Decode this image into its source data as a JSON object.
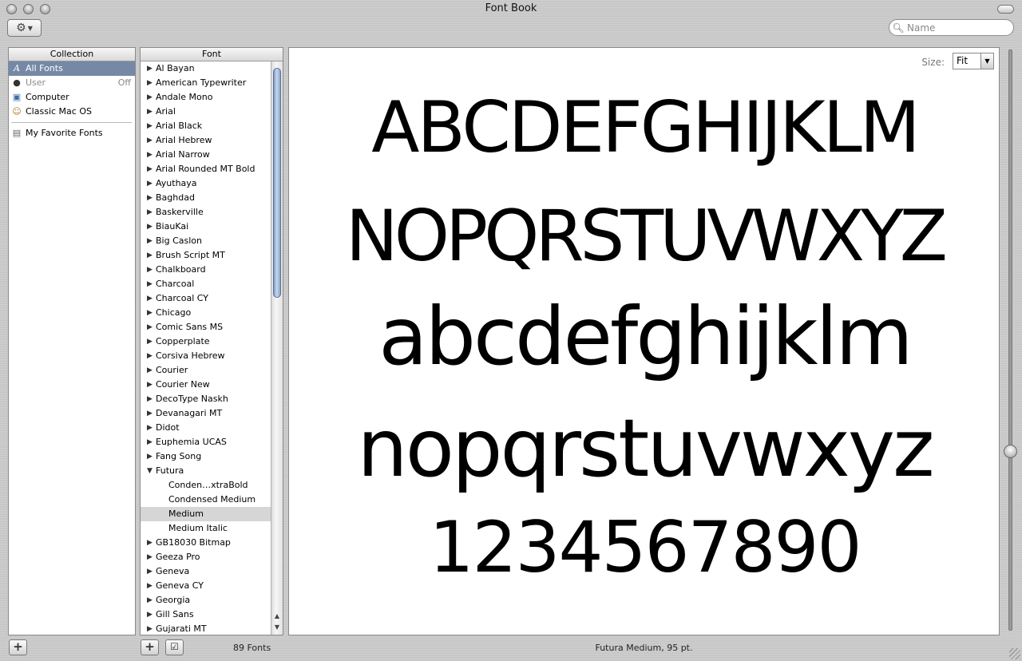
{
  "window": {
    "title": "Font Book"
  },
  "search": {
    "placeholder": "Name",
    "value": ""
  },
  "collection": {
    "header": "Collection",
    "items": [
      {
        "label": "All Fonts",
        "icon": "font-icon",
        "selected": true
      },
      {
        "label": "User",
        "icon": "user-icon",
        "status": "Off",
        "disabled": true
      },
      {
        "label": "Computer",
        "icon": "computer-icon"
      },
      {
        "label": "Classic Mac OS",
        "icon": "mac-os-icon"
      },
      {
        "label": "My Favorite Fonts",
        "icon": "collection-book-icon"
      }
    ]
  },
  "fonts": {
    "header": "Font",
    "count_label": "89 Fonts",
    "families_before": [
      "Al Bayan",
      "American Typewriter",
      "Andale Mono",
      "Arial",
      "Arial Black",
      "Arial Hebrew",
      "Arial Narrow",
      "Arial Rounded MT Bold",
      "Ayuthaya",
      "Baghdad",
      "Baskerville",
      "BiauKai",
      "Big Caslon",
      "Brush Script MT",
      "Chalkboard",
      "Charcoal",
      "Charcoal CY",
      "Chicago",
      "Comic Sans MS",
      "Copperplate",
      "Corsiva Hebrew",
      "Courier",
      "Courier New",
      "DecoType Naskh",
      "Devanagari MT",
      "Didot",
      "Euphemia UCAS",
      "Fang Song"
    ],
    "expanded_family": "Futura",
    "faces": [
      "Conden…xtraBold",
      "Condensed Medium",
      "Medium",
      "Medium Italic"
    ],
    "selected_face": "Medium",
    "families_after": [
      "GB18030 Bitmap",
      "Geeza Pro",
      "Geneva",
      "Geneva CY",
      "Georgia",
      "Gill Sans",
      "Gujarati MT"
    ]
  },
  "preview": {
    "size_label": "Size:",
    "size_value": "Fit",
    "lines": [
      "ABCDEFGHIJKLM",
      "NOPQRSTUVWXYZ",
      "abcdefghijklm",
      "nopqrstuvwxyz",
      "1234567890"
    ],
    "status": "Futura Medium, 95 pt."
  }
}
